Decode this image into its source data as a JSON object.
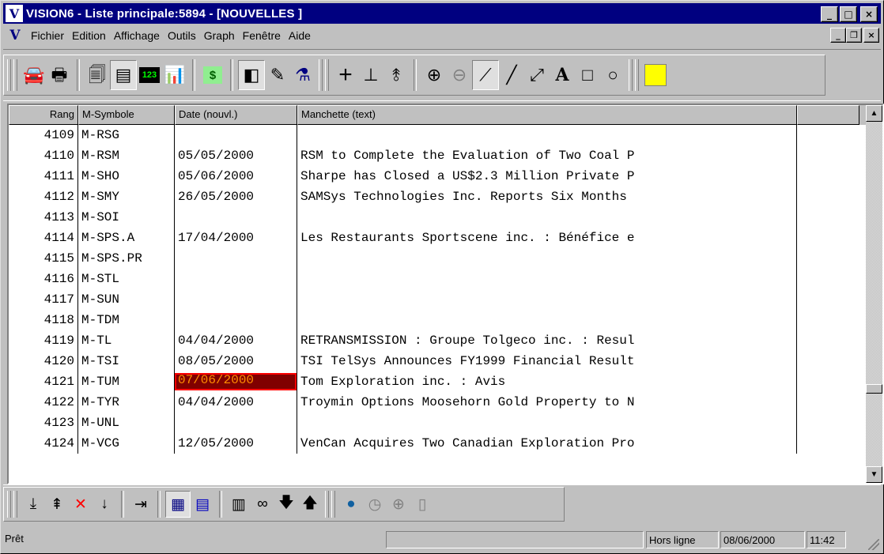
{
  "window": {
    "title": "VISION6 - Liste principale:5894 - [NOUVELLES ]",
    "logo_glyph": "V",
    "minimize": "_",
    "maximize": "□",
    "close": "×"
  },
  "menubar": {
    "items": [
      {
        "label": "Fichier"
      },
      {
        "label": "Edition"
      },
      {
        "label": "Affichage"
      },
      {
        "label": "Outils"
      },
      {
        "label": "Graph"
      },
      {
        "label": "Fenêtre"
      },
      {
        "label": "Aide"
      }
    ],
    "mdi_minimize": "_",
    "mdi_restore": "❐",
    "mdi_close": "×"
  },
  "toolbar": {
    "icons": [
      "car-icon",
      "printer-icon",
      "doc-icon",
      "sheet-icon",
      "123-icon",
      "chart-icon",
      "money-icon",
      "panel-icon",
      "edit-icon",
      "wizard-icon",
      "crosshair-icon",
      "ruler-icon",
      "fork-icon",
      "zoom-in-icon",
      "zoom-out-icon",
      "trend-line-icon",
      "line-icon",
      "arrow-line-icon",
      "text-icon",
      "rectangle-icon",
      "ellipse-icon",
      "color-swatch-icon"
    ],
    "glyphs": {
      "car": "🚘",
      "printer": "🖶",
      "doc": "🗐",
      "sheet": "▤",
      "num": "123",
      "chart": "📊",
      "money": "$",
      "panel": "◧",
      "edit": "✎",
      "wizard": "⚗",
      "crosshair": "+",
      "ruler": "⊥",
      "fork": "⥉",
      "zoom_in": "⊕",
      "zoom_out": "⊖",
      "trend": "⟋",
      "line": "╱",
      "arrow": "⤢",
      "text": "A",
      "rect": "□",
      "ellipse": "○"
    },
    "accent_color": "#ffff00"
  },
  "grid": {
    "columns": [
      "Rang",
      "M-Symbole",
      "Date (nouvl.)",
      "Manchette (text)"
    ],
    "rows": [
      {
        "rang": "4109",
        "symbole": "M-RSG",
        "date": "",
        "manchette": ""
      },
      {
        "rang": "4110",
        "symbole": "M-RSM",
        "date": "05/05/2000",
        "manchette": "RSM to Complete the Evaluation of Two Coal P"
      },
      {
        "rang": "4111",
        "symbole": "M-SHO",
        "date": "05/06/2000",
        "manchette": "Sharpe has Closed a US$2.3 Million Private P"
      },
      {
        "rang": "4112",
        "symbole": "M-SMY",
        "date": "26/05/2000",
        "manchette": "SAMSys Technologies Inc. Reports Six Months"
      },
      {
        "rang": "4113",
        "symbole": "M-SOI",
        "date": "",
        "manchette": ""
      },
      {
        "rang": "4114",
        "symbole": "M-SPS.A",
        "date": "17/04/2000",
        "manchette": "Les Restaurants Sportscene inc. : Bénéfice e"
      },
      {
        "rang": "4115",
        "symbole": "M-SPS.PR",
        "date": "",
        "manchette": ""
      },
      {
        "rang": "4116",
        "symbole": "M-STL",
        "date": "",
        "manchette": ""
      },
      {
        "rang": "4117",
        "symbole": "M-SUN",
        "date": "",
        "manchette": ""
      },
      {
        "rang": "4118",
        "symbole": "M-TDM",
        "date": "",
        "manchette": ""
      },
      {
        "rang": "4119",
        "symbole": "M-TL",
        "date": "04/04/2000",
        "manchette": "RETRANSMISSION : Groupe Tolgeco inc. : Resul"
      },
      {
        "rang": "4120",
        "symbole": "M-TSI",
        "date": "08/05/2000",
        "manchette": "TSI TelSys Announces FY1999 Financial Result"
      },
      {
        "rang": "4121",
        "symbole": "M-TUM",
        "date": "07/06/2000",
        "manchette": "Tom Exploration inc. : Avis",
        "highlight": true
      },
      {
        "rang": "4122",
        "symbole": "M-TYR",
        "date": "04/04/2000",
        "manchette": "Troymin Options Moosehorn Gold Property to N"
      },
      {
        "rang": "4123",
        "symbole": "M-UNL",
        "date": "",
        "manchette": ""
      },
      {
        "rang": "4124",
        "symbole": "M-VCG",
        "date": "12/05/2000",
        "manchette": "VenCan Acquires Two Canadian Exploration Pro"
      }
    ],
    "highlight_bg": "#800000",
    "highlight_fg": "#ff8c00",
    "scroll_position": 0.78
  },
  "bottom_toolbar": {
    "glyphs": {
      "sort_down": "⤓",
      "sort_top": "⇞",
      "delete": "✕",
      "sort_num": "↓",
      "insert": "⇥",
      "grid_a": "▦",
      "grid_b": "▤",
      "table": "▥",
      "binoculars": "∞",
      "down": "🡇",
      "up": "🡅",
      "globe": "●",
      "clock": "◷",
      "target": "⊕",
      "doc": "▯"
    }
  },
  "statusbar": {
    "status": "Prêt",
    "mode": "Hors ligne",
    "date": "08/06/2000",
    "time": "11:42"
  }
}
